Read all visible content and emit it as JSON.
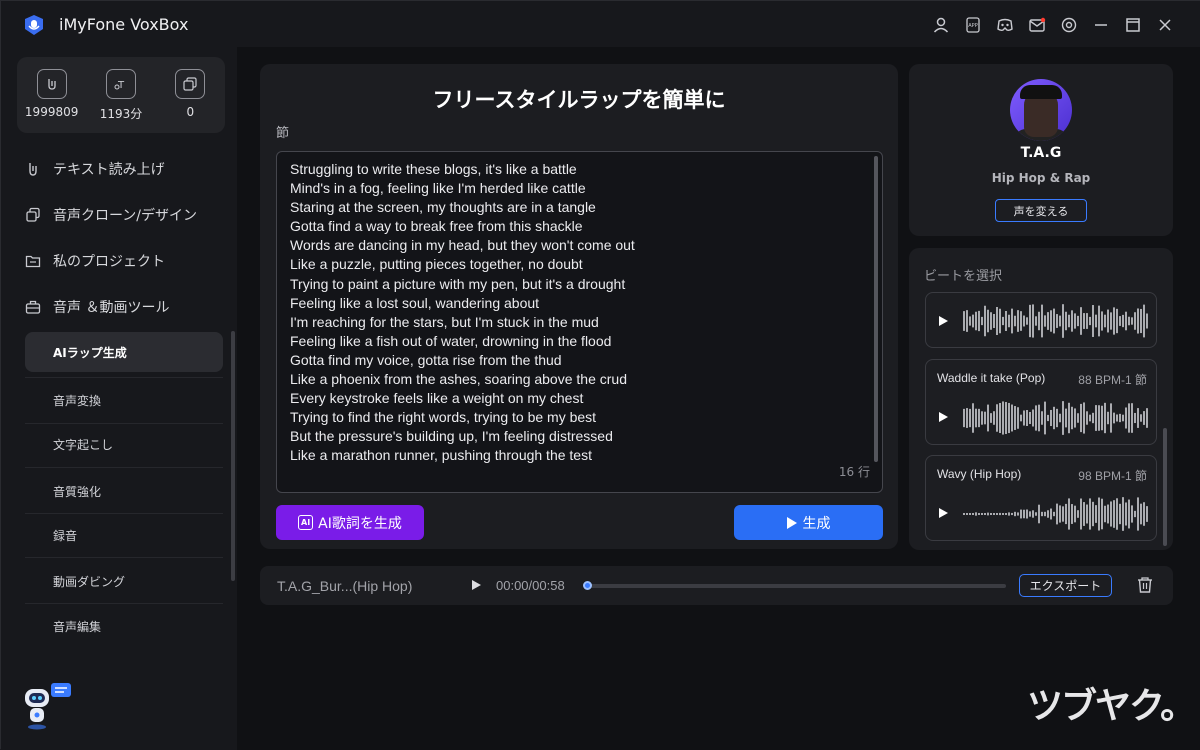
{
  "app": {
    "title": "iMyFone VoxBox"
  },
  "stats": [
    {
      "value": "1999809",
      "icon": "voice-char-icon"
    },
    {
      "value": "1193分",
      "icon": "time-icon"
    },
    {
      "value": "0",
      "icon": "clone-icon"
    }
  ],
  "sidebar": {
    "items": [
      {
        "label": "テキスト読み上げ"
      },
      {
        "label": "音声クローン/デザイン"
      },
      {
        "label": "私のプロジェクト"
      },
      {
        "label": "音声 ＆動画ツール"
      }
    ],
    "sub_items": [
      {
        "label": "AIラップ生成",
        "active": true
      },
      {
        "label": "音声変換"
      },
      {
        "label": "文字起こし"
      },
      {
        "label": "音質強化"
      },
      {
        "label": "録音"
      },
      {
        "label": "動画ダビング"
      },
      {
        "label": "音声編集"
      }
    ]
  },
  "editor": {
    "title": "フリースタイルラップを簡単に",
    "section_label": "節",
    "lyrics": "Struggling to write these blogs, it's like a battle\nMind's in a fog, feeling like I'm herded like cattle\nStaring at the screen, my thoughts are in a tangle\nGotta find a way to break free from this shackle\nWords are dancing in my head, but they won't come out\nLike a puzzle, putting pieces together, no doubt\nTrying to paint a picture with my pen, but it's a drought\nFeeling like a lost soul, wandering about\nI'm reaching for the stars, but I'm stuck in the mud\nFeeling like a fish out of water, drowning in the flood\nGotta find my voice, gotta rise from the thud\nLike a phoenix from the ashes, soaring above the crud\nEvery keystroke feels like a weight on my chest\nTrying to find the right words, trying to be my best\nBut the pressure's building up, I'm feeling distressed\nLike a marathon runner, pushing through the test",
    "line_count": "16 行",
    "ai_button": "AI歌詞を生成",
    "ai_icon_text": "AI",
    "generate_button": "生成"
  },
  "profile": {
    "name": "T.A.G",
    "genre": "Hip Hop & Rap",
    "change_button": "声を変える"
  },
  "beats": {
    "label": "ビートを選択",
    "items": [
      {
        "name": "",
        "bpm": ""
      },
      {
        "name": "Waddle it take (Pop)",
        "bpm": "88 BPM-1 節"
      },
      {
        "name": "Wavy (Hip Hop)",
        "bpm": "98 BPM-1 節"
      }
    ]
  },
  "player": {
    "file_name": "T.A.G_Bur...(Hip Hop)",
    "time": "00:00/00:58",
    "progress": 0.0,
    "export_button": "エクスポート"
  },
  "watermark": "ツブヤク。",
  "colors": {
    "accent_blue": "#2a6ef5",
    "accent_purple": "#7a1ce8",
    "background": "#17181c",
    "panel": "#1c1d21"
  }
}
